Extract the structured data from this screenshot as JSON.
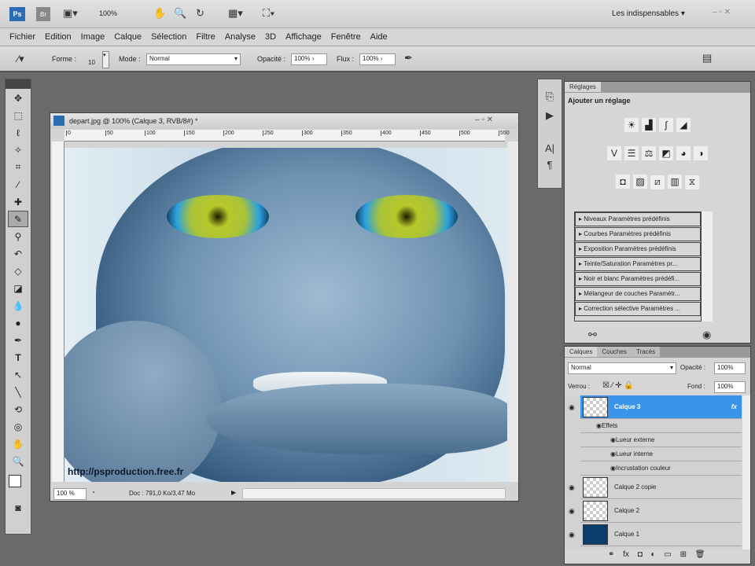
{
  "appbar": {
    "zoom": "100%",
    "workspace": "Les indispensables"
  },
  "menu": [
    "Fichier",
    "Edition",
    "Image",
    "Calque",
    "Sélection",
    "Filtre",
    "Analyse",
    "3D",
    "Affichage",
    "Fenêtre",
    "Aide"
  ],
  "options": {
    "forme_label": "Forme :",
    "brush_size": "10",
    "mode_label": "Mode :",
    "mode_value": "Normal",
    "opacity_label": "Opacité :",
    "opacity_value": "100%",
    "flux_label": "Flux :",
    "flux_value": "100%"
  },
  "document": {
    "title": "depart.jpg @ 100% (Calque 3, RVB/8#) *",
    "ruler": [
      "0",
      "50",
      "100",
      "150",
      "200",
      "250",
      "300",
      "350",
      "400",
      "450",
      "500",
      "550"
    ],
    "watermark": "http://psproduction.free.fr",
    "zoom": "100 %",
    "doc_info": "Doc : 791,0 Ko/3,47 Mo"
  },
  "reglages": {
    "tab": "Réglages",
    "heading": "Ajouter un réglage",
    "presets": [
      "Niveaux Paramètres prédéfinis",
      "Courbes Paramètres prédéfinis",
      "Exposition Paramètres prédéfinis",
      "Teinte/Saturation Paramètres pr...",
      "Noir et blanc Paramètres prédéfi...",
      "Mélangeur de couches Paramètr...",
      "Correction sélective Paramètres ..."
    ]
  },
  "layers": {
    "tabs": [
      "Calques",
      "Couches",
      "Tracés"
    ],
    "blend": "Normal",
    "opacity_label": "Opacité :",
    "opacity": "100%",
    "lock_label": "Verrou :",
    "fill_label": "Fond :",
    "fill": "100%",
    "items": [
      {
        "name": "Calque 3",
        "selected": true
      },
      {
        "name": "Calque 2 copie"
      },
      {
        "name": "Calque 2"
      },
      {
        "name": "Calque 1"
      }
    ],
    "effects_label": "Effets",
    "effects": [
      "Lueur externe",
      "Lueur interne",
      "Incrustation couleur"
    ]
  },
  "colors": {
    "selection": "#3a95e8",
    "layer1": "#0a3d6b"
  }
}
